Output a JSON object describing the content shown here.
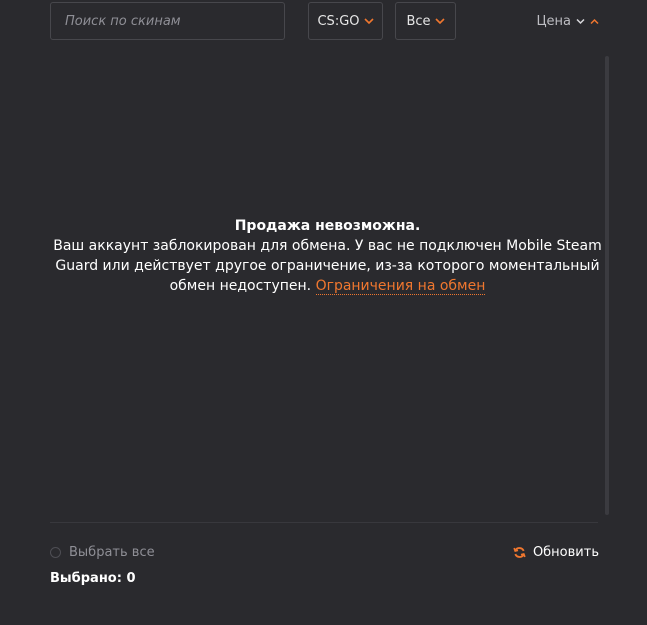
{
  "colors": {
    "background": "#2a2a2e",
    "border": "#47474c",
    "accent": "#f0772f",
    "muted_text": "#8f8f96"
  },
  "filters": {
    "search": {
      "placeholder": "Поиск по скинам",
      "value": ""
    },
    "game_select": {
      "value": "CS:GO",
      "icon": "chevron-down-icon"
    },
    "type_select": {
      "value": "Все",
      "icon": "chevron-down-icon"
    },
    "sort": {
      "label": "Цена",
      "icons": [
        "chevron-down-icon",
        "chevron-up-icon"
      ]
    }
  },
  "message": {
    "title": "Продажа невозможна.",
    "body": "Ваш аккаунт заблокирован для обмена. У вас не подключен Mobile Steam Guard или действует другое ограничение, из-за которого моментальный обмен недоступен.",
    "link": "Ограничения на обмен"
  },
  "footer": {
    "select_all": "Выбрать все",
    "refresh": {
      "label": "Обновить",
      "icon": "refresh-icon"
    },
    "selected": "Выбрано: 0"
  }
}
